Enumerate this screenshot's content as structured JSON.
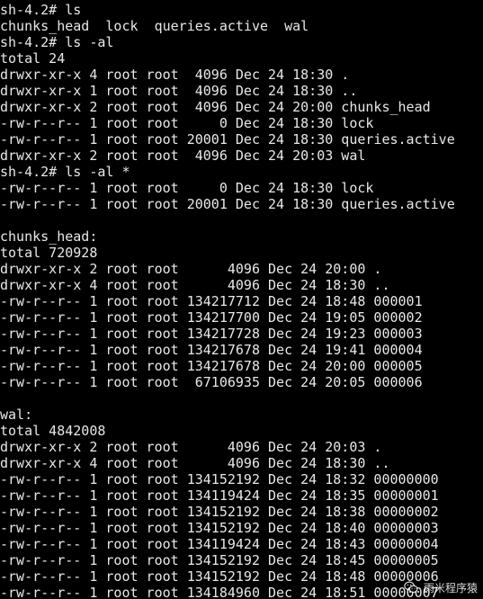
{
  "terminal": {
    "lines": [
      "sh-4.2# ls",
      "chunks_head  lock  queries.active  wal",
      "sh-4.2# ls -al",
      "total 24",
      "drwxr-xr-x 4 root root  4096 Dec 24 18:30 .",
      "drwxr-xr-x 1 root root  4096 Dec 24 18:30 ..",
      "drwxr-xr-x 2 root root  4096 Dec 24 20:00 chunks_head",
      "-rw-r--r-- 1 root root     0 Dec 24 18:30 lock",
      "-rw-r--r-- 1 root root 20001 Dec 24 18:30 queries.active",
      "drwxr-xr-x 2 root root  4096 Dec 24 20:03 wal",
      "sh-4.2# ls -al *",
      "-rw-r--r-- 1 root root     0 Dec 24 18:30 lock",
      "-rw-r--r-- 1 root root 20001 Dec 24 18:30 queries.active",
      "",
      "chunks_head:",
      "total 720928",
      "drwxr-xr-x 2 root root      4096 Dec 24 20:00 .",
      "drwxr-xr-x 4 root root      4096 Dec 24 18:30 ..",
      "-rw-r--r-- 1 root root 134217712 Dec 24 18:48 000001",
      "-rw-r--r-- 1 root root 134217700 Dec 24 19:05 000002",
      "-rw-r--r-- 1 root root 134217728 Dec 24 19:23 000003",
      "-rw-r--r-- 1 root root 134217678 Dec 24 19:41 000004",
      "-rw-r--r-- 1 root root 134217678 Dec 24 20:00 000005",
      "-rw-r--r-- 1 root root  67106935 Dec 24 20:05 000006",
      "",
      "wal:",
      "total 4842008",
      "drwxr-xr-x 2 root root      4096 Dec 24 20:03 .",
      "drwxr-xr-x 4 root root      4096 Dec 24 18:30 ..",
      "-rw-r--r-- 1 root root 134152192 Dec 24 18:32 00000000",
      "-rw-r--r-- 1 root root 134119424 Dec 24 18:35 00000001",
      "-rw-r--r-- 1 root root 134152192 Dec 24 18:38 00000002",
      "-rw-r--r-- 1 root root 134152192 Dec 24 18:40 00000003",
      "-rw-r--r-- 1 root root 134119424 Dec 24 18:43 00000004",
      "-rw-r--r-- 1 root root 134152192 Dec 24 18:45 00000005",
      "-rw-r--r-- 1 root root 134152192 Dec 24 18:48 00000006",
      "-rw-r--r-- 1 root root 134184960 Dec 24 18:51 00000007"
    ]
  },
  "watermark": {
    "text": "雨米程序猿",
    "icon": "wechat-logo-icon"
  },
  "colors": {
    "background": "#000000",
    "text": "#e8e8e8"
  }
}
